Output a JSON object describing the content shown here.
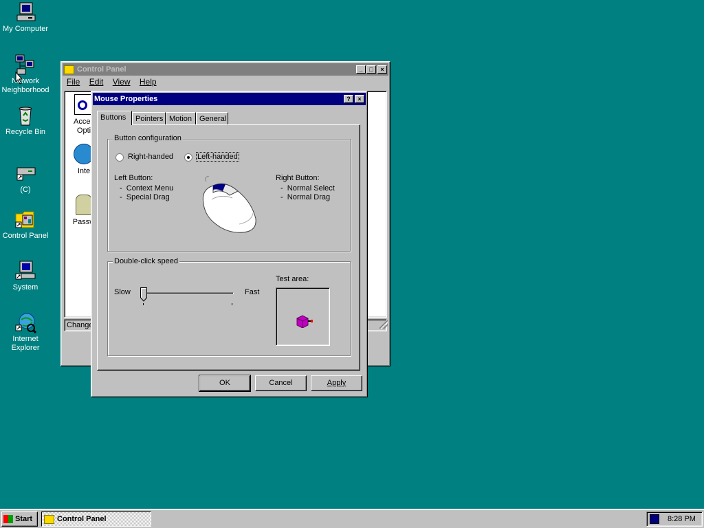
{
  "desktop": {
    "icons": [
      {
        "label": "My Computer"
      },
      {
        "label": "Network Neighborhood"
      },
      {
        "label": "Recycle Bin"
      },
      {
        "label": "(C)"
      },
      {
        "label": "Control Panel"
      },
      {
        "label": "System"
      },
      {
        "label": "Internet Explorer"
      }
    ]
  },
  "control_panel": {
    "title": "Control Panel",
    "menu": [
      "File",
      "Edit",
      "View",
      "Help"
    ],
    "items": [
      "Accessibility Options",
      "Internet",
      "Passwords"
    ],
    "visible_item_text": [
      "Acces",
      "Opti",
      "Inte",
      "Passw"
    ],
    "status_text": "Change"
  },
  "mouse_properties": {
    "title": "Mouse Properties",
    "tabs": [
      "Buttons",
      "Pointers",
      "Motion",
      "General"
    ],
    "selected_tab": "Buttons",
    "button_config": {
      "group_label": "Button configuration",
      "right_handed_label": "Right-handed",
      "left_handed_label": "Left-handed",
      "selected": "Left-handed",
      "left_button_heading": "Left Button:",
      "left_button_items": [
        "-  Context Menu",
        "-  Special Drag"
      ],
      "right_button_heading": "Right Button:",
      "right_button_items": [
        "-  Normal Select",
        "-  Normal Drag"
      ]
    },
    "double_click": {
      "group_label": "Double-click speed",
      "slow_label": "Slow",
      "fast_label": "Fast",
      "speed_fraction": 0.0,
      "test_area_label": "Test area:"
    },
    "buttons": {
      "ok": "OK",
      "cancel": "Cancel",
      "apply": "Apply"
    }
  },
  "taskbar": {
    "start_label": "Start",
    "task_label": "Control Panel",
    "clock": "8:28 PM"
  }
}
